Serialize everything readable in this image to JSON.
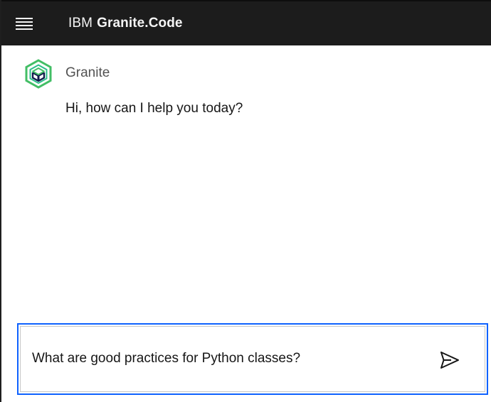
{
  "header": {
    "menu_icon": "hamburger-menu-icon",
    "brand_prefix": "IBM",
    "brand_name": "Granite.Code"
  },
  "conversation": {
    "messages": [
      {
        "sender": "Granite",
        "avatar_icon": "granite-logo-icon",
        "text": "Hi, how can I help you today?"
      }
    ]
  },
  "composer": {
    "value": "What are good practices for Python classes?",
    "send_icon": "send-icon"
  },
  "colors": {
    "header_bg": "#1c1c1c",
    "focus_border": "#0f62fe",
    "logo_green": "#42be65",
    "logo_navy": "#0f1b4c"
  }
}
